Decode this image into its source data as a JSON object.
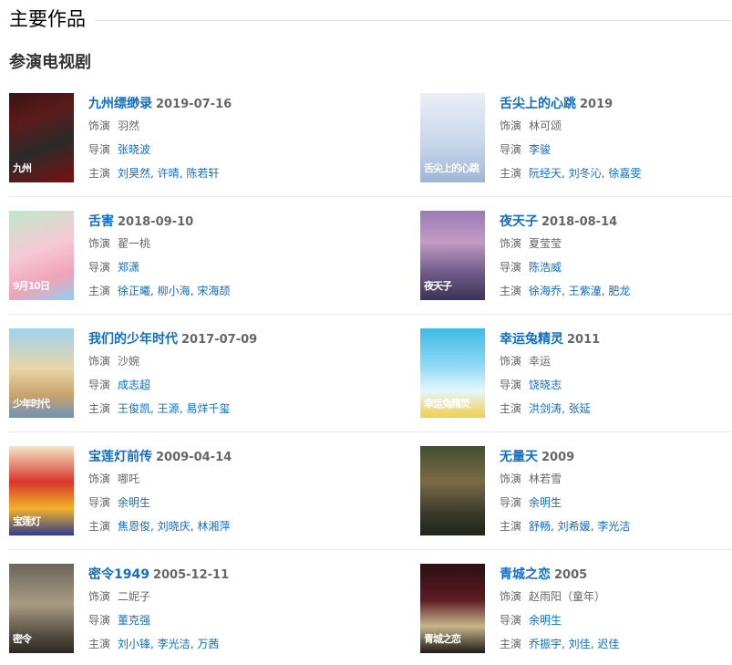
{
  "section": {
    "title": "主要作品"
  },
  "subsection": {
    "title": "参演电视剧"
  },
  "labels": {
    "role": "饰演",
    "director": "导演",
    "cast": "主演"
  },
  "works": [
    {
      "title": "九州缥缈录",
      "date": "2019-07-16",
      "role": "羽然",
      "director": [
        "张晓波"
      ],
      "cast": [
        "刘昊然",
        "许晴",
        "陈若轩"
      ],
      "poster_text": "九州"
    },
    {
      "title": "舌尖上的心跳",
      "date": "2019",
      "role": "林可颂",
      "director": [
        "李骏"
      ],
      "cast": [
        "阮经天",
        "刘冬沁",
        "徐嘉雯"
      ],
      "poster_text": "舌尖上的心跳"
    },
    {
      "title": "舌害",
      "date": "2018-09-10",
      "role": "翟一桃",
      "director": [
        "郑潇"
      ],
      "cast": [
        "徐正曦",
        "柳小海",
        "宋海颉"
      ],
      "poster_text": "9月10日"
    },
    {
      "title": "夜天子",
      "date": "2018-08-14",
      "role": "夏莹莹",
      "director": [
        "陈浩威"
      ],
      "cast": [
        "徐海乔",
        "王紫潼",
        "肥龙"
      ],
      "poster_text": "夜天子"
    },
    {
      "title": "我们的少年时代",
      "date": "2017-07-09",
      "role": "沙婉",
      "director": [
        "成志超"
      ],
      "cast": [
        "王俊凯",
        "王源",
        "易烊千玺"
      ],
      "poster_text": "少年时代"
    },
    {
      "title": "幸运兔精灵",
      "date": "2011",
      "role": "幸运",
      "director": [
        "饶晓志"
      ],
      "cast": [
        "洪剑涛",
        "张延"
      ],
      "poster_text": "幸运兔精灵"
    },
    {
      "title": "宝莲灯前传",
      "date": "2009-04-14",
      "role": "哪吒",
      "director": [
        "余明生"
      ],
      "cast": [
        "焦恩俊",
        "刘晓庆",
        "林湘萍"
      ],
      "poster_text": "宝莲灯"
    },
    {
      "title": "无量天",
      "date": "2009",
      "role": "林若雪",
      "director": [
        "余明生"
      ],
      "cast": [
        "舒畅",
        "刘希媛",
        "李光洁"
      ],
      "poster_text": ""
    },
    {
      "title": "密令1949",
      "date": "2005-12-11",
      "role": "二妮子",
      "director": [
        "董克强"
      ],
      "cast": [
        "刘小锋",
        "李光洁",
        "万茜"
      ],
      "poster_text": "密令"
    },
    {
      "title": "青城之恋",
      "date": "2005",
      "role": "赵雨阳（童年）",
      "director": [
        "余明生"
      ],
      "cast": [
        "乔振宇",
        "刘佳",
        "迟佳"
      ],
      "poster_text": "青城之恋"
    }
  ]
}
